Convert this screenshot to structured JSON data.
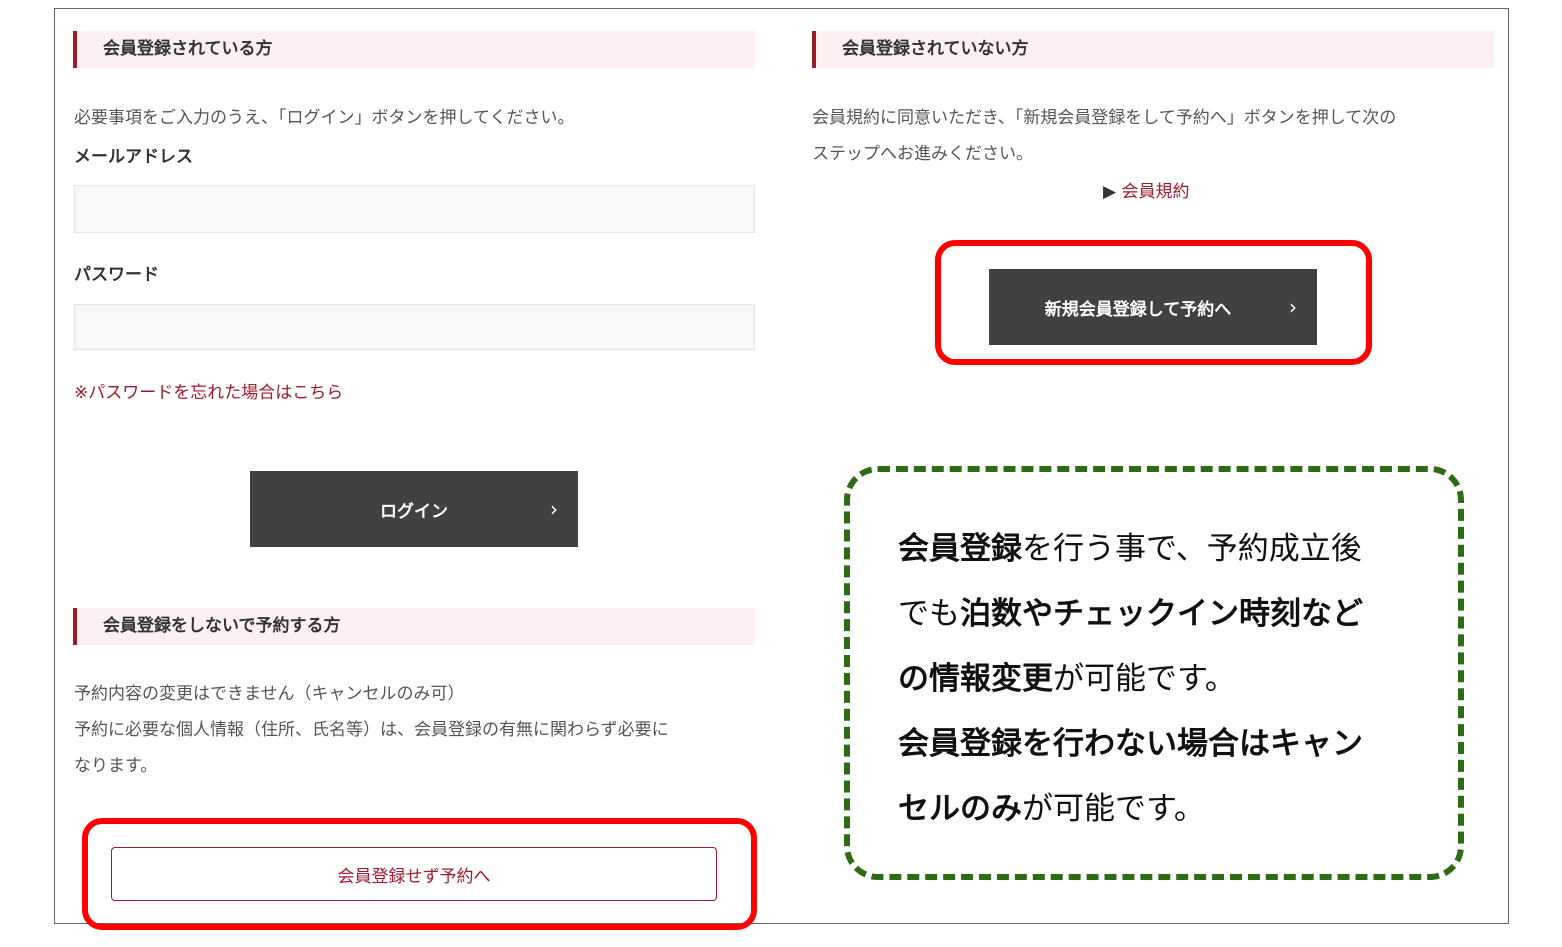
{
  "members": {
    "heading": "会員登録されている方",
    "instruction": "必要事項をご入力のうえ、「ログイン」ボタンを押してください。",
    "email_label": "メールアドレス",
    "email_value": "",
    "password_label": "パスワード",
    "password_value": "",
    "forgot_link": "※パスワードを忘れた場合はこちら",
    "login_label": "ログイン",
    "chevron": "›"
  },
  "guest": {
    "heading": "会員登録をしないで予約する方",
    "note_line1": "予約内容の変更はできません（キャンセルのみ可）",
    "note_line2": "予約に必要な個人情報（住所、氏名等）は、会員登録の有無に関わらず必要に",
    "note_line3": "なります。",
    "button_label": "会員登録せず予約へ"
  },
  "nonmembers": {
    "heading": "会員登録されていない方",
    "instruction_line1": "会員規約に同意いただき、「新規会員登録をして予約へ」ボタンを押して次の",
    "instruction_line2": "ステップへお進みください。",
    "terms_marker": "▶",
    "terms_link": "会員規約",
    "register_label": "新規会員登録して予約へ",
    "chevron": "›"
  },
  "callout": {
    "l1_bold": "会員登録",
    "l1_rest": "を行う事で、予約成立後",
    "l2_plain": "でも",
    "l2_bold": "泊数やチェックイン時刻など",
    "l3_bold": "の情報変更",
    "l3_rest": "が可能です。",
    "l4_bold": "会員登録を行わない場合はキャン",
    "l5_bold": "セルのみ",
    "l5_rest": "が可能です。"
  },
  "colors": {
    "accent": "#a11a2b",
    "button_dark": "#414141",
    "highlight_red": "#ff0000",
    "callout_green": "#2e6b14",
    "heading_bg": "#fcf0f2"
  }
}
